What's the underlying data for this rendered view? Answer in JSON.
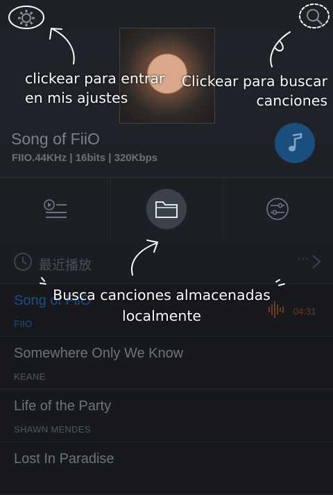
{
  "now_playing": {
    "title": "Song of FiiO",
    "meta": "FIIO.44KHz | 16bits | 320Kbps"
  },
  "recent": {
    "label": "最近播放",
    "more": "···"
  },
  "songs": [
    {
      "title": "Song of FiiO",
      "artist": "FIIO",
      "time": "04:31",
      "active": true
    },
    {
      "title": "Somewhere Only We Know",
      "artist": "KEANE"
    },
    {
      "title": "Life of the Party",
      "artist": "SHAWN MENDES"
    },
    {
      "title": "Lost In Paradise",
      "artist": ""
    }
  ],
  "annotations": {
    "settings_note": "clickear para entrar en mis ajustes",
    "search_note": "Clickear para buscar canciones",
    "folder_note": "Busca canciones almacenadas localmente"
  },
  "icons": {
    "settings": "gear-icon",
    "search": "search-icon",
    "play": "music-note-icon",
    "playlist": "playlist-icon",
    "folder": "folder-icon",
    "equalizer": "equalizer-icon",
    "history": "clock-icon",
    "chevron": "chevron-right-icon"
  },
  "colors": {
    "accent": "#1a4f7d",
    "background": "#17191d",
    "annotation": "#ffffff"
  }
}
